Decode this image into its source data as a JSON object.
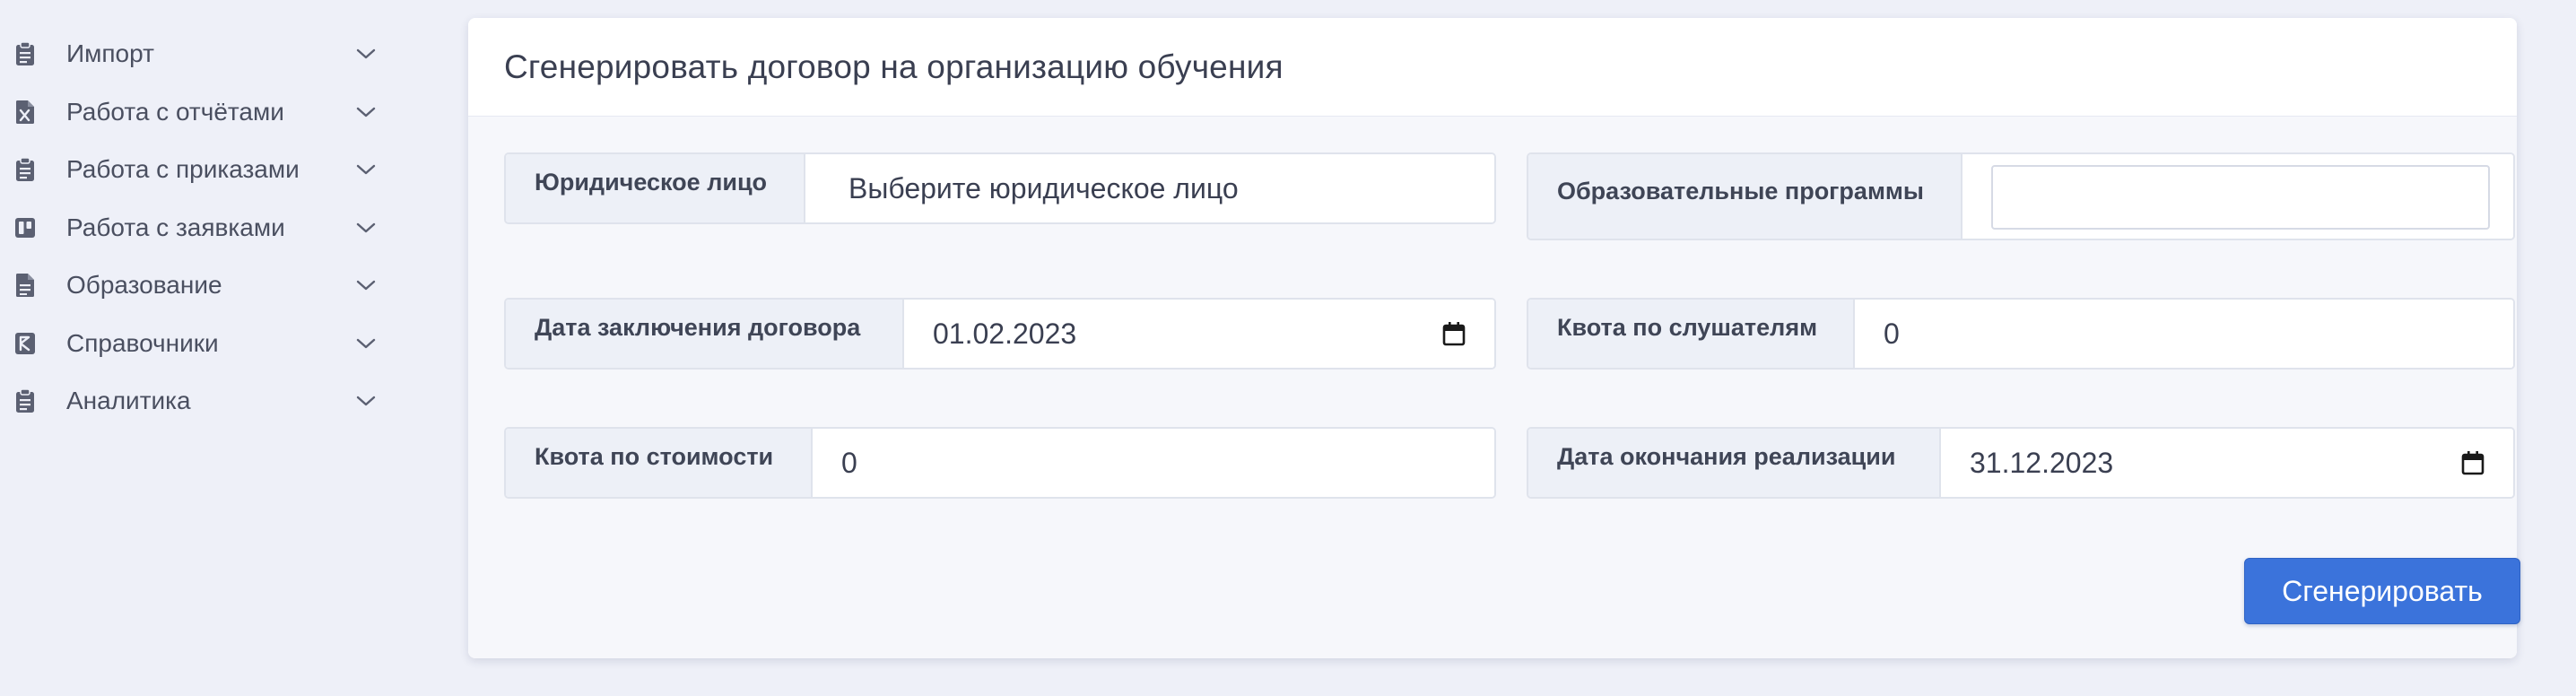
{
  "sidebar": {
    "items": [
      {
        "label": "Импорт",
        "icon": "clipboard-icon"
      },
      {
        "label": "Работа с отчётами",
        "icon": "excel-file-icon"
      },
      {
        "label": "Работа с приказами",
        "icon": "clipboard-icon"
      },
      {
        "label": "Работа с заявками",
        "icon": "kanban-icon"
      },
      {
        "label": "Образование",
        "icon": "document-icon"
      },
      {
        "label": "Справочники",
        "icon": "book-icon"
      },
      {
        "label": "Аналитика",
        "icon": "clipboard-icon"
      }
    ]
  },
  "card": {
    "title": "Сгенерировать договор на организацию обучения"
  },
  "form": {
    "legal_entity": {
      "label": "Юридическое лицо",
      "placeholder": "Выберите юридическое лицо"
    },
    "programs": {
      "label": "Образовательные программы",
      "value": ""
    },
    "contract_date": {
      "label": "Дата заключения договора",
      "value": "01.02.2023"
    },
    "listeners_quota": {
      "label": "Квота по слушателям",
      "value": "0"
    },
    "cost_quota": {
      "label": "Квота по стоимости",
      "value": "0"
    },
    "end_date": {
      "label": "Дата окончания реализации",
      "value": "31.12.2023"
    }
  },
  "actions": {
    "generate_label": "Сгенерировать"
  },
  "colors": {
    "background": "#eef0f8",
    "accent": "#3b73db",
    "label_bg": "#edf0f7"
  }
}
